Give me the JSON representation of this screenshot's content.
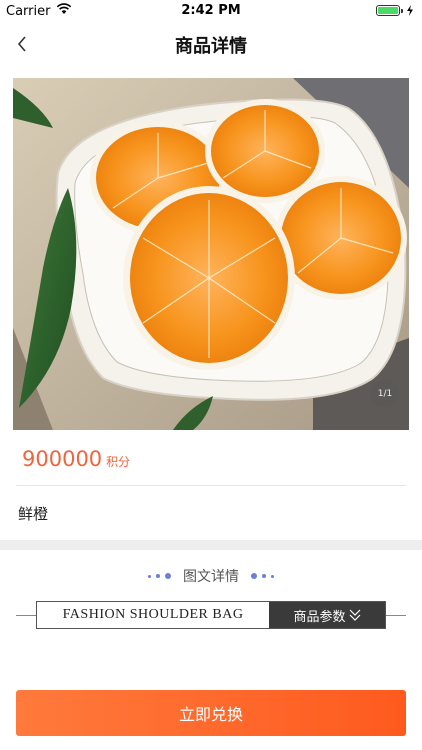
{
  "status_bar": {
    "carrier": "Carrier",
    "time": "2:42 PM",
    "battery_color": "#4cd964"
  },
  "nav": {
    "title": "商品详情",
    "back_icon": "chevron-left-icon"
  },
  "product": {
    "image_subject": "sliced-oranges-on-plate",
    "image_badge": "1/1",
    "price": "900000",
    "price_unit": "积分",
    "name": "鲜橙"
  },
  "details": {
    "section_title": "图文详情",
    "banner_text": "FASHION SHOULDER BAG",
    "banner_tag": "商品参数"
  },
  "action": {
    "redeem_label": "立即兑换"
  },
  "colors": {
    "accent": "#f0643c",
    "button_start": "#ff7a3c",
    "button_end": "#ff5a1e",
    "dots": "#6a80d8"
  }
}
